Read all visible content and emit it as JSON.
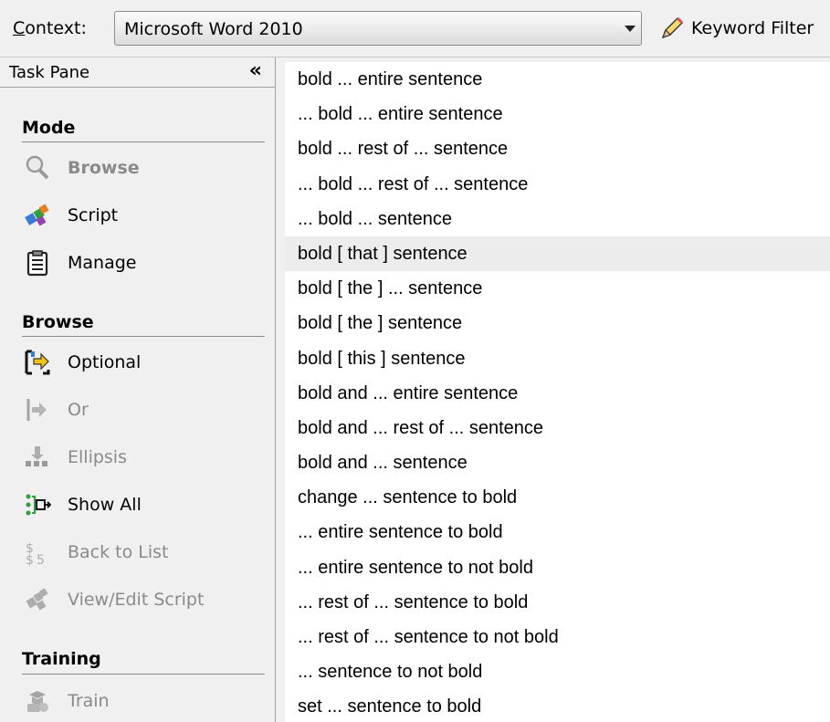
{
  "context": {
    "label_accesskey": "C",
    "label_rest": "ontext:",
    "selected": "Microsoft Word 2010",
    "keyword_filter_label": "Keyword Filter"
  },
  "task_pane": {
    "title": "Task Pane",
    "collapse_glyph": "«",
    "sections": {
      "mode": {
        "title": "Mode",
        "items": [
          {
            "label": "Browse",
            "icon": "magnifier-icon",
            "enabled": false
          },
          {
            "label": "Script",
            "icon": "puzzle-icon",
            "enabled": true
          },
          {
            "label": "Manage",
            "icon": "clipboard-icon",
            "enabled": true
          }
        ]
      },
      "browse": {
        "title": "Browse",
        "items": [
          {
            "label": "Optional",
            "icon": "optional-bracket-icon",
            "enabled": true
          },
          {
            "label": "Or",
            "icon": "or-arrow-icon",
            "enabled": false
          },
          {
            "label": "Ellipsis",
            "icon": "ellipsis-icon",
            "enabled": false
          },
          {
            "label": "Show All",
            "icon": "show-all-icon",
            "enabled": true
          },
          {
            "label": "Back to List",
            "icon": "back-to-list-icon",
            "enabled": false
          },
          {
            "label": "View/Edit Script",
            "icon": "view-edit-script-icon",
            "enabled": false
          }
        ]
      },
      "training": {
        "title": "Training",
        "items": [
          {
            "label": "Train",
            "icon": "train-icon",
            "enabled": false
          }
        ]
      }
    }
  },
  "commands": [
    "bold ... entire sentence",
    "... bold ... entire sentence",
    "bold ... rest of ... sentence",
    "... bold ... rest of ... sentence",
    "... bold ... sentence",
    "bold [ that ] sentence",
    "bold [ the ] ... sentence",
    "bold [ the ] sentence",
    "bold [ this ] sentence",
    "bold and ... entire sentence",
    "bold and ... rest of ... sentence",
    "bold and ... sentence",
    "change ... sentence to bold",
    "... entire sentence to bold",
    "... entire sentence to not bold",
    "... rest of ... sentence to bold",
    "... rest of ... sentence to not bold",
    "... sentence to not bold",
    "set ... sentence to bold"
  ],
  "highlighted_command_index": 5,
  "colors": {
    "highlight": "#ececec",
    "disabled_text": "#8a8a8a"
  }
}
